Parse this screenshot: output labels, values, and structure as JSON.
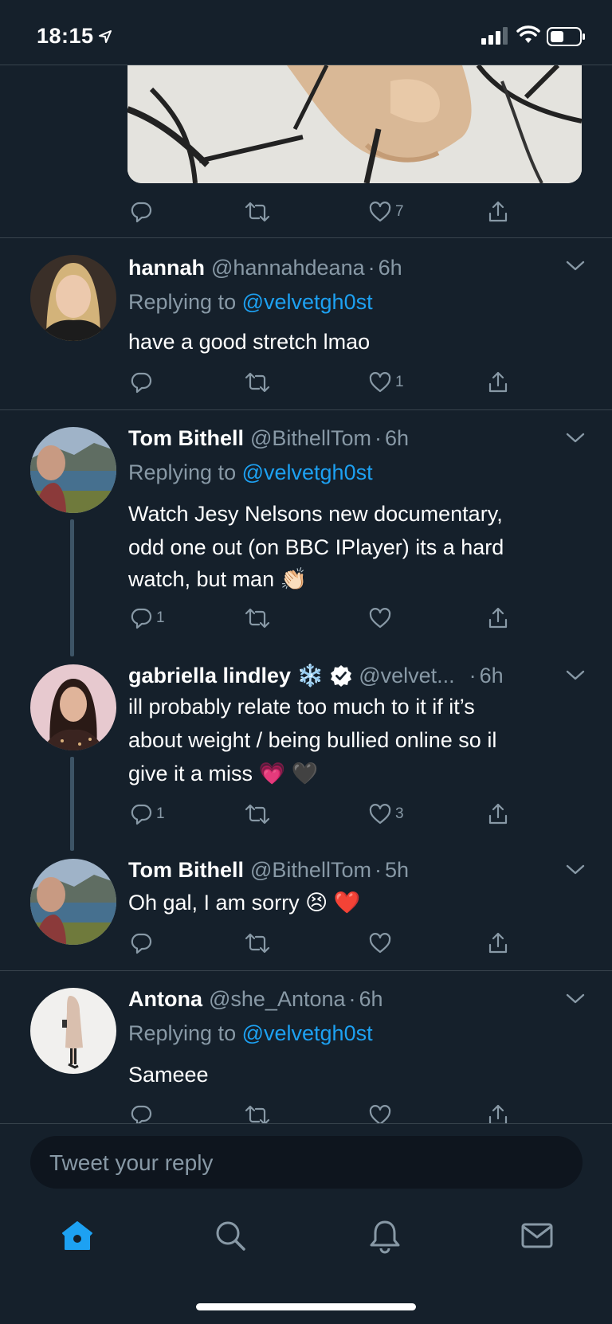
{
  "status": {
    "time": "18:15"
  },
  "tweets": [
    {
      "counts": {
        "reply": "",
        "retweet": "",
        "like": "7"
      }
    },
    {
      "name": "hannah",
      "handle": "@hannahdeana",
      "time": "6h",
      "replying_prefix": "Replying to ",
      "replying_to": "@velvetgh0st",
      "text_lines": [
        "have a good stretch lmao"
      ],
      "counts": {
        "reply": "",
        "retweet": "",
        "like": "1"
      }
    },
    {
      "name": "Tom Bithell",
      "handle": "@BithellTom",
      "time": "6h",
      "replying_prefix": "Replying to ",
      "replying_to": "@velvetgh0st",
      "text_lines": [
        "Watch Jesy Nelsons new documentary,",
        "odd one out (on BBC IPlayer) its a hard",
        "watch, but man 👏🏻"
      ],
      "counts": {
        "reply": "1",
        "retweet": "",
        "like": ""
      }
    },
    {
      "name": "gabriella lindley ❄️",
      "handle": "@velvet...",
      "time": "6h",
      "verified": true,
      "text_lines": [
        "ill probably relate too much to it if it’s",
        "about weight / being bullied online so il",
        "give it a miss 💗 🖤"
      ],
      "counts": {
        "reply": "1",
        "retweet": "",
        "like": "3"
      }
    },
    {
      "name": "Tom Bithell",
      "handle": "@BithellTom",
      "time": "5h",
      "text_lines": [
        "Oh gal, I am sorry 😣 ❤️"
      ],
      "counts": {
        "reply": "",
        "retweet": "",
        "like": ""
      }
    },
    {
      "name": "Antona",
      "handle": "@she_Antona",
      "time": "6h",
      "replying_prefix": "Replying to ",
      "replying_to": "@velvetgh0st",
      "text_lines": [
        "Sameee"
      ],
      "counts": {
        "reply": "",
        "retweet": "",
        "like": ""
      }
    }
  ],
  "composer": {
    "placeholder": "Tweet your reply"
  },
  "tabbar": [
    "home-icon",
    "search-icon",
    "notifications-icon",
    "messages-icon"
  ],
  "colors": {
    "background": "#15202b",
    "accent": "#1da1f2",
    "secondary_text": "#8899a6",
    "divider": "#38444d"
  }
}
